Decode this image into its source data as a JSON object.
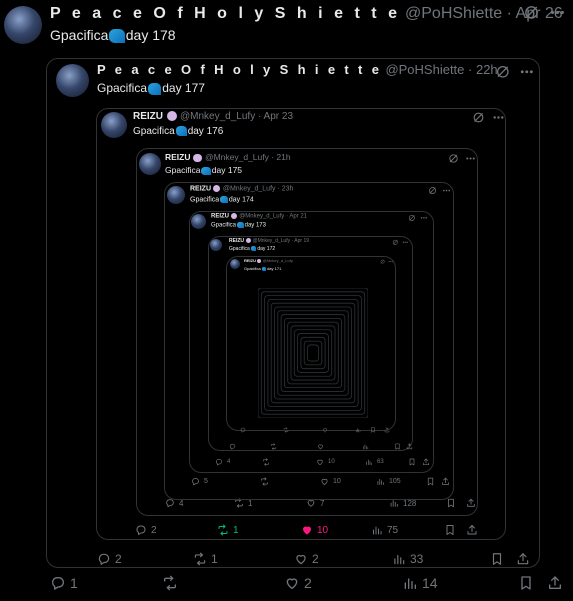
{
  "tweets": [
    {
      "display_name": "P e a c e O f  H o l y S h i e t t e",
      "handle": "@PoHShiette",
      "time": "Apr 26",
      "text_before": "Gpacifica",
      "text_after": "day 178",
      "replies": "1",
      "retweets": "",
      "likes": "2",
      "views": "14"
    },
    {
      "display_name": "P e a c e O f  H o l y S h i e t t e",
      "handle": "@PoHShiette",
      "time": "22h",
      "text_before": "Gpacifica",
      "text_after": "day 177",
      "replies": "2",
      "retweets": "1",
      "likes": "2",
      "views": "33"
    },
    {
      "display_name": "REIZU",
      "handle": "@Mnkey_d_Lufy",
      "time": "Apr 23",
      "text_before": "Gpacifica",
      "text_after": "day 176",
      "replies": "2",
      "retweets": "1",
      "likes": "10",
      "views": "75"
    },
    {
      "display_name": "REIZU",
      "handle": "@Mnkey_d_Lufy",
      "time": "21h",
      "text_before": "Gpacifica",
      "text_after": "day 175",
      "replies": "4",
      "retweets": "1",
      "likes": "7",
      "views": "128"
    },
    {
      "display_name": "REIZU",
      "handle": "@Mnkey_d_Lufy",
      "time": "23h",
      "text_before": "Gpacifica",
      "text_after": "day 174",
      "replies": "5",
      "retweets": "",
      "likes": "10",
      "views": "105"
    },
    {
      "display_name": "REIZU",
      "handle": "@Mnkey_d_Lufy",
      "time": "Apr 21",
      "text_before": "Gpacifica",
      "text_after": "day 173",
      "replies": "4",
      "retweets": "",
      "likes": "10",
      "views": "63"
    },
    {
      "display_name": "REIZU",
      "handle": "@Mnkey_d_Lufy",
      "time": "Apr 19",
      "text_before": "Gpacifica",
      "text_after": "day 172",
      "replies": "",
      "retweets": "",
      "likes": "",
      "views": ""
    },
    {
      "display_name": "REIZU",
      "handle": "@Mnkey_d_Lufy",
      "time": "",
      "text_before": "Gpacifica",
      "text_after": "day 171",
      "replies": "",
      "retweets": "",
      "likes": "",
      "views": ""
    }
  ],
  "colors": {
    "accent": "#1d9bf0",
    "retweet": "#00ba7c",
    "like": "#f91880",
    "muted": "#71767b"
  },
  "icons": {
    "reply": "reply-icon",
    "retweet": "retweet-icon",
    "like": "heart-icon",
    "views": "views-icon",
    "bookmark": "bookmark-icon",
    "share": "share-icon",
    "grok": "grok-icon",
    "more": "more-icon",
    "verified": "verified-icon",
    "wave": "wave-emoji-icon"
  }
}
